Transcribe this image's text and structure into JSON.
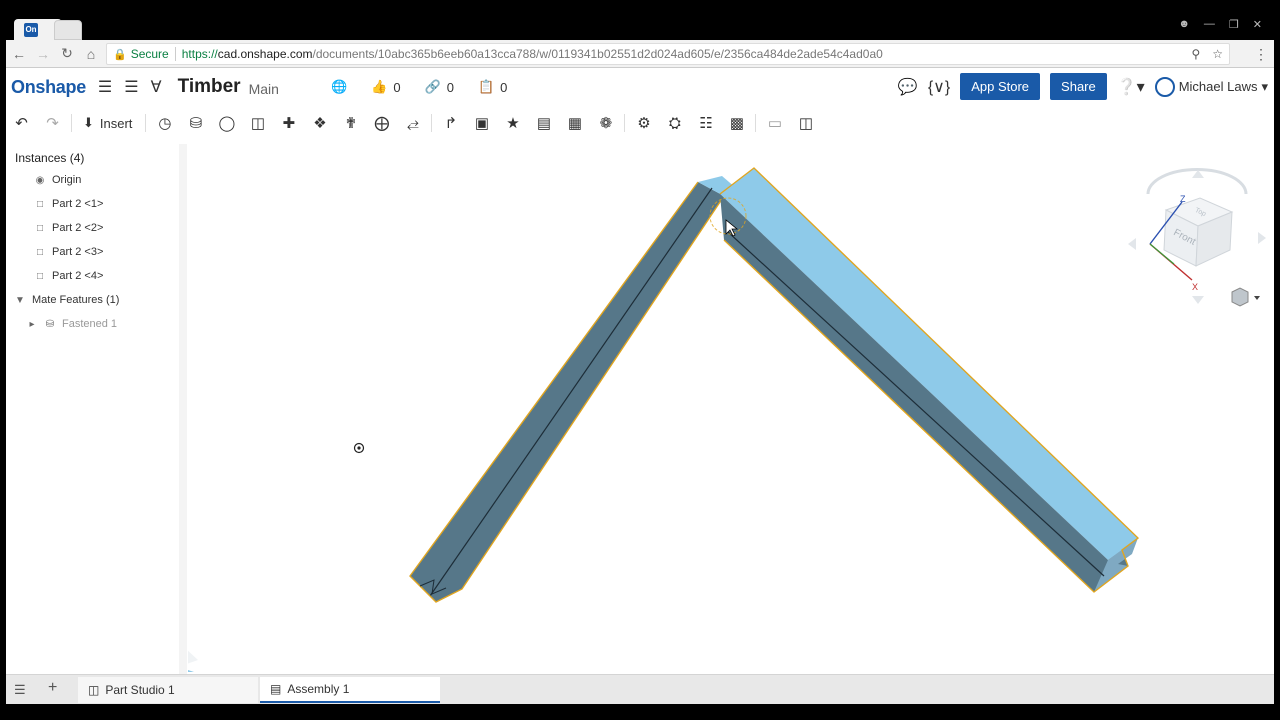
{
  "browser": {
    "tab_favicon": "On",
    "address": {
      "secure_label": "Secure",
      "url_scheme": "https://",
      "url_host": "cad.onshape.com",
      "url_path": "/documents/10abc365b6eeb60a13cca788/w/0119341b02551d2d024ad605/e/2356ca484de2ade54c4ad0a0"
    }
  },
  "app": {
    "logo": "Onshape",
    "document_title": "Timber",
    "branch": "Main",
    "likes_count": "0",
    "links_count": "0",
    "copies_count": "0",
    "app_store_label": "App Store",
    "share_label": "Share",
    "user_name": "Michael Laws"
  },
  "toolbar": {
    "insert_label": "Insert"
  },
  "sidebar": {
    "instances_header": "Instances (4)",
    "items": [
      {
        "label": "Origin",
        "icon": "origin-icon"
      },
      {
        "label": "Part 2 <1>",
        "icon": "part-icon"
      },
      {
        "label": "Part 2 <2>",
        "icon": "part-icon"
      },
      {
        "label": "Part 2 <3>",
        "icon": "part-icon"
      },
      {
        "label": "Part 2 <4>",
        "icon": "part-icon"
      }
    ],
    "mate_features_header": "Mate Features (1)",
    "mate_items": [
      {
        "label": "Fastened 1",
        "icon": "fastened-mate-icon"
      }
    ]
  },
  "viewcube": {
    "face_label": "Front",
    "top_label": "Top",
    "axis_z": "Z",
    "axis_x": "X"
  },
  "bottom_tabs": [
    {
      "label": "Part Studio 1",
      "active": false
    },
    {
      "label": "Assembly 1",
      "active": true
    }
  ],
  "colors": {
    "brand": "#1a5aa8",
    "part_face_light": "#8ecae9",
    "part_face_dark": "#567789",
    "selection_outline": "#e0a520"
  }
}
